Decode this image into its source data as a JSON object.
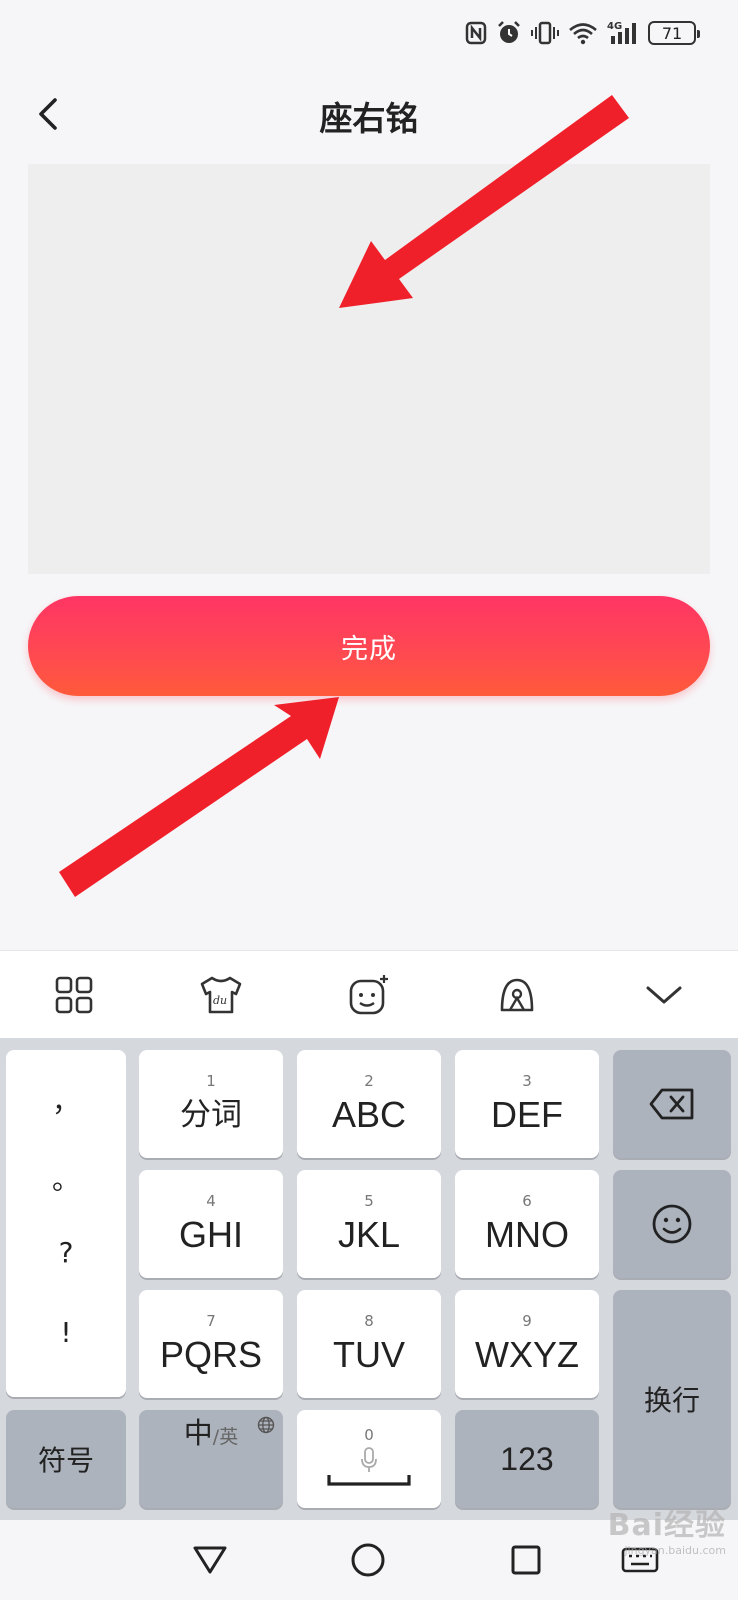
{
  "status_bar": {
    "battery_level": "71",
    "network": "4G",
    "icons": [
      "nfc-icon",
      "alarm-icon",
      "vibrate-icon",
      "wifi-icon",
      "signal-icon",
      "battery-icon"
    ]
  },
  "header": {
    "title": "座右铭",
    "back_icon": "chevron-left-icon"
  },
  "motto_input": {
    "value": "",
    "placeholder": ""
  },
  "done_button": {
    "label": "完成",
    "gradient_top": "#ff3565",
    "gradient_bottom": "#ff5a3a"
  },
  "annotation_arrows": {
    "color": "#f0202a"
  },
  "keyboard_toolbar": {
    "icons": [
      "grid-menu-icon",
      "du-skin-icon",
      "emoji-face-plus-icon",
      "handwriting-icon",
      "chevron-down-icon"
    ]
  },
  "keyboard": {
    "punctuation": [
      "，",
      "。",
      "?",
      "!"
    ],
    "keys": [
      {
        "num": "1",
        "label": "分词"
      },
      {
        "num": "2",
        "label": "ABC"
      },
      {
        "num": "3",
        "label": "DEF"
      },
      {
        "num": "4",
        "label": "GHI"
      },
      {
        "num": "5",
        "label": "JKL"
      },
      {
        "num": "6",
        "label": "MNO"
      },
      {
        "num": "7",
        "label": "PQRS"
      },
      {
        "num": "8",
        "label": "TUV"
      },
      {
        "num": "9",
        "label": "WXYZ"
      }
    ],
    "symbols_label": "符号",
    "lang_main": "中",
    "lang_sub": "/英",
    "space_num": "0",
    "numbers_label": "123",
    "enter_label": "换行",
    "backspace_icon": "backspace-icon",
    "emoji_icon": "smiley-icon",
    "globe_icon": "globe-icon",
    "mic_icon": "microphone-icon"
  },
  "nav_bar": {
    "icons": [
      "back-triangle-icon",
      "home-circle-icon",
      "recents-square-icon",
      "keyboard-switch-icon"
    ]
  },
  "watermark": {
    "text": "Bai经验",
    "sub": "jingyan.baidu.com"
  }
}
